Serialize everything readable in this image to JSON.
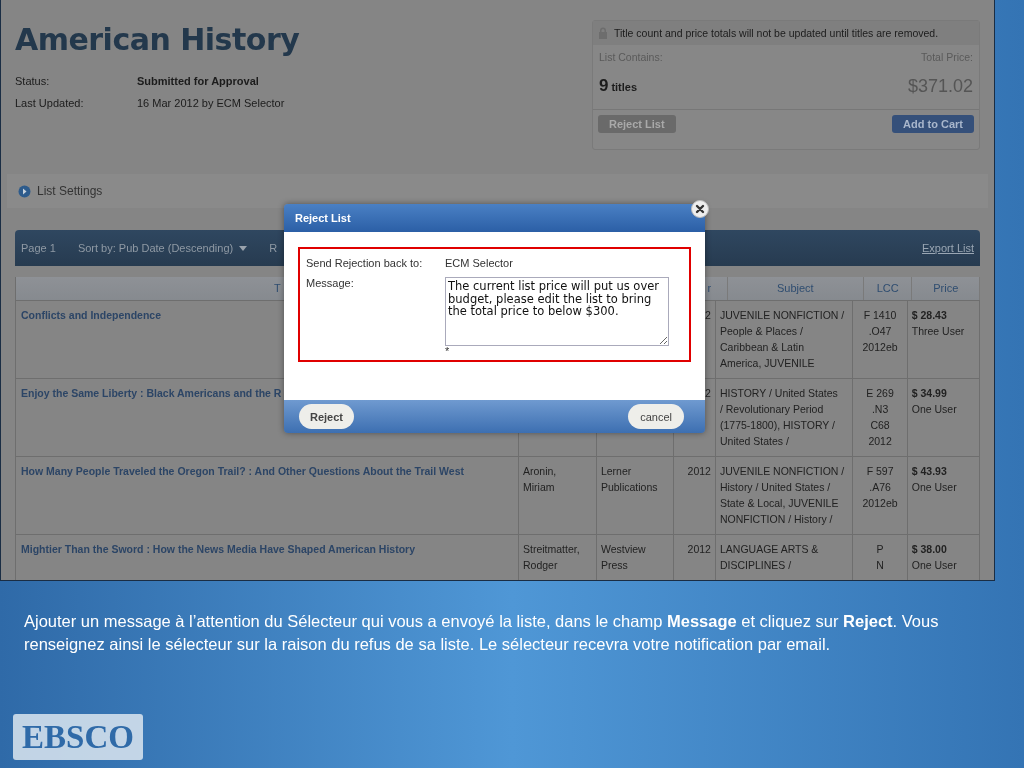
{
  "page": {
    "title": "American History",
    "meta": [
      {
        "label": "Status:",
        "value": "Submitted for Approval",
        "strong": true
      },
      {
        "label": "Last Updated:",
        "value": "16 Mar 2012 by ECM Selector",
        "strong": false
      }
    ]
  },
  "summary": {
    "notice": "Title count and price totals will not be updated until titles are removed.",
    "contains_label": "List Contains:",
    "price_label": "Total Price:",
    "count": "9",
    "count_unit": "titles",
    "total": "$371.02",
    "reject_button": {
      "label": "Reject List",
      "disabled": true
    },
    "cart_button": {
      "label": "Add to Cart",
      "disabled": false
    }
  },
  "list_settings": {
    "label": "List Settings",
    "expanded": false
  },
  "toolbar": {
    "page": "Page 1",
    "sort": "Sort by: Pub Date (Descending)",
    "item_3": "R",
    "export": "Export List"
  },
  "table": {
    "header": {
      "column_1": "T",
      "column_4": "r",
      "subject": "Subject",
      "lcc": "LCC",
      "price": "Price"
    },
    "rows": [
      {
        "title": "Conflicts and Independence",
        "author": [],
        "publisher": [],
        "year": "2",
        "subject": [
          "JUVENILE NONFICTION /",
          "People & Places /",
          "Caribbean & Latin",
          "America, JUVENILE"
        ],
        "lcc": [
          "F 1410",
          ".O47",
          "2012eb"
        ],
        "price": "$ 28.43",
        "license": "Three User"
      },
      {
        "title": "Enjoy the Same Liberty : Black Americans and the R",
        "author": [],
        "publisher": [],
        "year": "2",
        "subject": [
          "HISTORY / United States",
          "/ Revolutionary Period",
          "(1775-1800), HISTORY /",
          "United States /"
        ],
        "lcc": [
          "E 269",
          ".N3",
          "C68",
          "2012"
        ],
        "price": "$ 34.99",
        "license": "One User"
      },
      {
        "title": "How Many People Traveled the Oregon Trail? : And Other Questions About the Trail West",
        "author": [
          "Aronin,",
          "Miriam"
        ],
        "publisher": [
          "Lerner",
          "Publications"
        ],
        "year": "2012",
        "subject": [
          "JUVENILE NONFICTION /",
          "History / United States /",
          "State & Local, JUVENILE",
          "NONFICTION / History /"
        ],
        "lcc": [
          "F 597",
          ".A76",
          "2012eb"
        ],
        "price": "$ 43.93",
        "license": "One User"
      },
      {
        "title": "Mightier Than the Sword : How the News Media Have Shaped American History",
        "author": [
          "Streitmatter,",
          "Rodger"
        ],
        "publisher": [
          "Westview",
          "Press"
        ],
        "year": "2012",
        "subject": [
          "LANGUAGE ARTS &",
          "DISCIPLINES /"
        ],
        "lcc": [
          "P",
          "N"
        ],
        "price": "$ 38.00",
        "license": "One User"
      }
    ]
  },
  "dialog": {
    "title": "Reject List",
    "recipient_label": "Send Rejection back to:",
    "recipient": "ECM Selector",
    "message_label": "Message:",
    "message": "The current list price will put us over budget, please edit the list to bring the total price to below $300.",
    "required_mark": "*",
    "reject_button": "Reject",
    "cancel_button": "cancel"
  },
  "caption": "Ajouter un message à l’attention du Sélecteur qui vous a envoyé la liste, dans le champ **Message** et cliquez sur **Reject**.  Vous renseignez ainsi le sélecteur sur la raison du refus de sa liste. Le sélecteur recevra votre notification par email.",
  "logo": "EBSCO"
}
